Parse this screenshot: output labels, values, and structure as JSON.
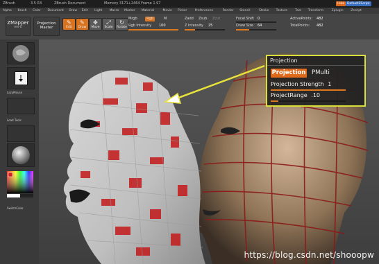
{
  "titlebar": {
    "items": [
      "ZBrush",
      "3.5 R3",
      "ZBrush Document",
      "Memory 3171+2464 Frame 1.97"
    ],
    "buttons": [
      {
        "label": "Hide",
        "color": "#e06a1c"
      },
      {
        "label": "DefaultZScript",
        "color": "#3a6fbf"
      }
    ]
  },
  "menubar": {
    "items": [
      "Alpha",
      "Brush",
      "Color",
      "Document",
      "Draw",
      "Edit",
      "Light",
      "Macro",
      "Marker",
      "Material",
      "Movie",
      "Picker",
      "Preferences",
      "Render",
      "Stencil",
      "Stroke",
      "Texture",
      "Tool",
      "Transform",
      "Zplugin",
      "Zscript"
    ]
  },
  "toolbar": {
    "zmapper": {
      "title": "ZMapper",
      "sub": "rev-E"
    },
    "projection_master": {
      "line1": "Projection",
      "line2": "Master"
    },
    "modes": [
      {
        "glyph": "✎",
        "label": "Edit",
        "active": true
      },
      {
        "glyph": "✎",
        "label": "Draw",
        "active": true
      },
      {
        "glyph": "✥",
        "label": "Move",
        "active": false
      },
      {
        "glyph": "⤢",
        "label": "Scale",
        "active": false
      },
      {
        "glyph": "↻",
        "label": "Rotate",
        "active": false
      }
    ],
    "mrgb_row": [
      "Mrgb",
      "Rgb",
      "M"
    ],
    "rgb_intensity": {
      "label": "Rgb Intensity",
      "value": "100",
      "level": 1.0
    },
    "zadd": "Zadd",
    "zsub": "Zsub",
    "zcut": "Zcut",
    "z_intensity": {
      "label": "Z Intensity",
      "value": "25",
      "level": 0.25
    },
    "focal_shift": {
      "label": "Focal Shift",
      "value": "0"
    },
    "draw_size": {
      "label": "Draw Size",
      "value": "64",
      "level": 0.32
    },
    "active_points": {
      "label": "ActivePoints:",
      "value": "482"
    },
    "total_points": {
      "label": "TotalPoints:",
      "value": "482"
    }
  },
  "lefttray": {
    "labels": [
      "LazyMouse",
      "Load Tools",
      "SwitchColor"
    ]
  },
  "projection_panel": {
    "header": "Projection",
    "projection_button": "Projection",
    "pmulti": "PMulti",
    "strength_label": "Projection Strength",
    "strength_value": "1",
    "strength_level": 1.0,
    "range_label": "ProjectRange",
    "range_value": ".10",
    "range_level": 0.1,
    "highlight_color": "#d8de3a",
    "accent": "#e06a1c"
  },
  "watermark": "https://blog.csdn.net/shooopw"
}
